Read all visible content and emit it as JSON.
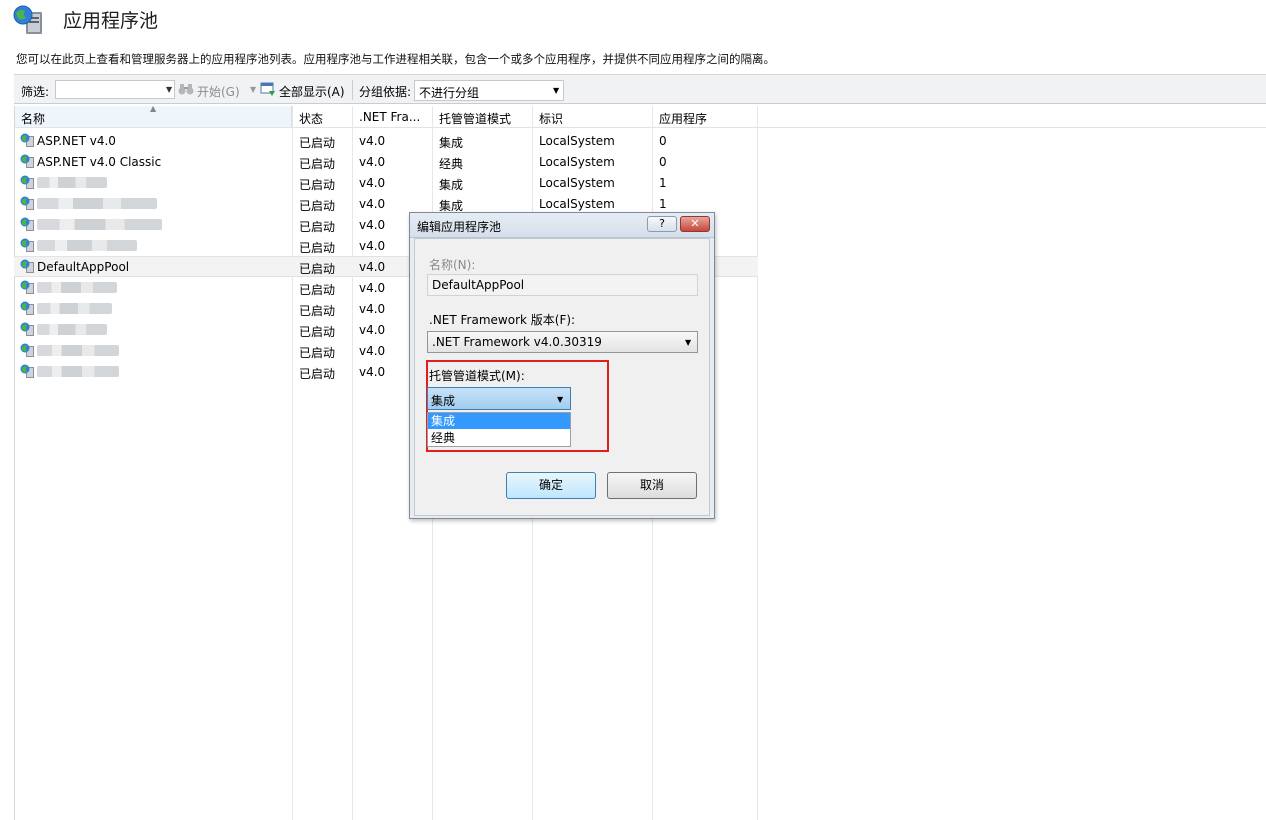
{
  "header": {
    "title": "应用程序池",
    "description": "您可以在此页上查看和管理服务器上的应用程序池列表。应用程序池与工作进程相关联，包含一个或多个应用程序，并提供不同应用程序之间的隔离。"
  },
  "toolbar": {
    "filter_label": "筛选:",
    "start_label": "开始(G)",
    "show_all_label": "全部显示(A)",
    "group_label": "分组依据:",
    "group_value": "不进行分组"
  },
  "columns": [
    "名称",
    "状态",
    ".NET Fra...",
    "托管管道模式",
    "标识",
    "应用程序"
  ],
  "rows": [
    {
      "name": "ASP.NET v4.0",
      "status": "已启动",
      "net": "v4.0",
      "mode": "集成",
      "identity": "LocalSystem",
      "apps": "0"
    },
    {
      "name": "ASP.NET v4.0 Classic",
      "status": "已启动",
      "net": "v4.0",
      "mode": "经典",
      "identity": "LocalSystem",
      "apps": "0"
    },
    {
      "name": "",
      "status": "已启动",
      "net": "v4.0",
      "mode": "集成",
      "identity": "LocalSystem",
      "apps": "1"
    },
    {
      "name": "",
      "status": "已启动",
      "net": "v4.0",
      "mode": "集成",
      "identity": "LocalSystem",
      "apps": "1"
    },
    {
      "name": "",
      "status": "已启动",
      "net": "v4.0",
      "mode": "",
      "identity": "",
      "apps": ""
    },
    {
      "name": "",
      "status": "已启动",
      "net": "v4.0",
      "mode": "",
      "identity": "",
      "apps": ""
    },
    {
      "name": "DefaultAppPool",
      "status": "已启动",
      "net": "v4.0",
      "mode": "",
      "identity": "",
      "apps": ""
    },
    {
      "name": "",
      "status": "已启动",
      "net": "v4.0",
      "mode": "",
      "identity": "",
      "apps": ""
    },
    {
      "name": "",
      "status": "已启动",
      "net": "v4.0",
      "mode": "",
      "identity": "",
      "apps": ""
    },
    {
      "name": "",
      "status": "已启动",
      "net": "v4.0",
      "mode": "",
      "identity": "",
      "apps": ""
    },
    {
      "name": "",
      "status": "已启动",
      "net": "v4.0",
      "mode": "",
      "identity": "",
      "apps": ""
    },
    {
      "name": "",
      "status": "已启动",
      "net": "v4.0",
      "mode": "",
      "identity": "",
      "apps": ""
    }
  ],
  "dialog": {
    "title": "编辑应用程序池",
    "help_label": "?",
    "close_label": "✕",
    "name_label": "名称(N):",
    "name_value": "DefaultAppPool",
    "framework_label": ".NET Framework 版本(F):",
    "framework_value": ".NET Framework v4.0.30319",
    "mode_label": "托管管道模式(M):",
    "mode_value": "集成",
    "mode_options": [
      "集成",
      "经典"
    ],
    "ok_label": "确定",
    "cancel_label": "取消"
  },
  "colors": {
    "selection": "#3399ff",
    "highlight_border": "#e0201e",
    "close_button": "#c8473a"
  }
}
